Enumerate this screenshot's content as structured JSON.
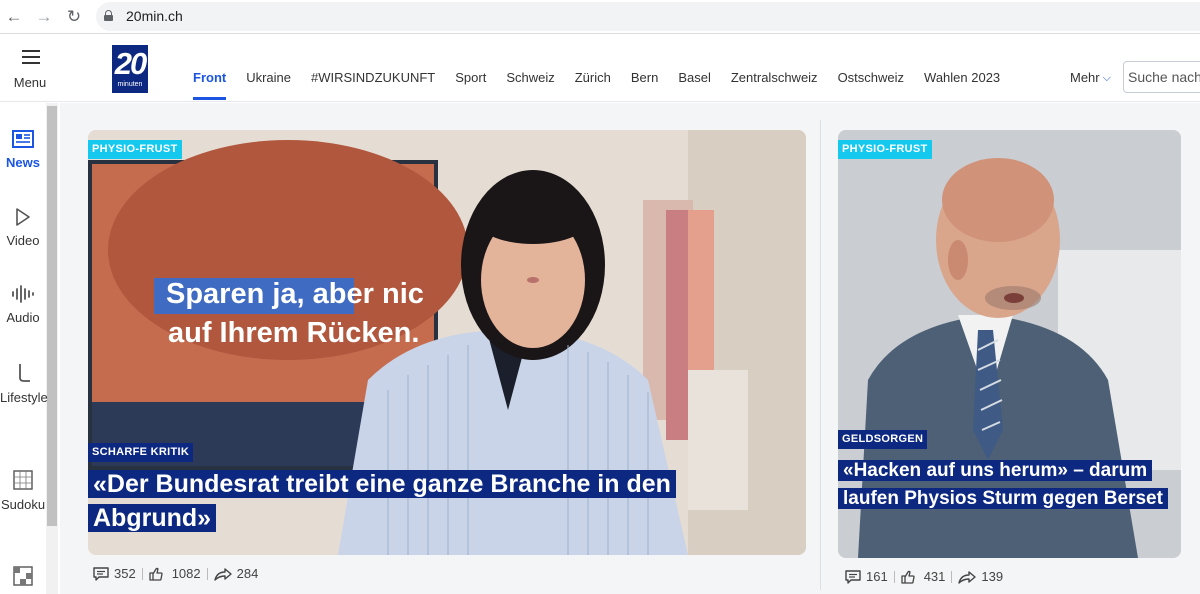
{
  "browser": {
    "url": "20min.ch"
  },
  "header": {
    "menu_label": "Menu",
    "logo": {
      "number": "20",
      "word": "minuten"
    },
    "nav": [
      "Front",
      "Ukraine",
      "#WIRSINDZUKUNFT",
      "Sport",
      "Schweiz",
      "Zürich",
      "Bern",
      "Basel",
      "Zentralschweiz",
      "Ostschweiz",
      "Wahlen 2023"
    ],
    "active_nav": "Front",
    "more_label": "Mehr",
    "search_placeholder": "Suche nach"
  },
  "rail": [
    {
      "label": "News",
      "icon": "newspaper-icon",
      "active": true
    },
    {
      "label": "Video",
      "icon": "play-icon",
      "active": false
    },
    {
      "label": "Audio",
      "icon": "waveform-icon",
      "active": false
    },
    {
      "label": "Lifestyle",
      "icon": "lifestyle-icon",
      "active": false
    },
    {
      "label": "Sudoku",
      "icon": "sudoku-icon",
      "active": false
    },
    {
      "label": "",
      "icon": "puzzle-grid-icon",
      "active": false
    }
  ],
  "main_article": {
    "top_tag": "PHYSIO-FRUST",
    "kicker": "SCHARFE KRITIK",
    "headline": "«Der Bundesrat treibt eine ganze Branche in den Abgrund»",
    "image_text": {
      "line1": "Sparen ja, aber nic",
      "line2": "auf Ihrem Rücken."
    },
    "comments": "352",
    "reactions": "1082",
    "shares": "284"
  },
  "side_article": {
    "top_tag": "PHYSIO-FRUST",
    "kicker": "GELDSORGEN",
    "headline": "«Hacken auf uns herum» – darum laufen Physios Sturm gegen Berset",
    "comments": "161",
    "reactions": "431",
    "shares": "139"
  },
  "colors": {
    "brand_blue": "#0d2880",
    "accent_blue": "#1b55e2",
    "tag_cyan": "#14c8ee"
  }
}
